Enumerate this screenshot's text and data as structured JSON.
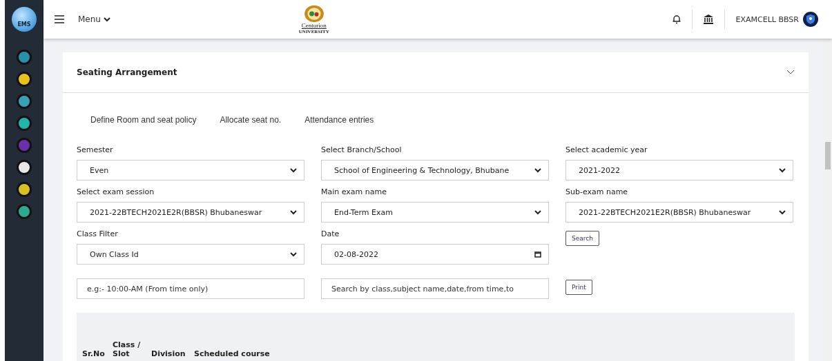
{
  "sidebar": {
    "logo": "EMS",
    "icons": [
      {
        "color": "#2a8fa8"
      },
      {
        "color": "#e8c21a"
      },
      {
        "color": "#3aa0b8"
      },
      {
        "color": "#1fb5a8"
      },
      {
        "color": "#6b2fa8"
      },
      {
        "color": "#e8e8e8"
      },
      {
        "color": "#d8c020"
      },
      {
        "color": "#2fa890"
      }
    ]
  },
  "topbar": {
    "menu": "Menu",
    "logo_name": "Centurion",
    "logo_sub": "UNIVERSITY",
    "user": "EXAMCELL BBSR"
  },
  "panel": {
    "title": "Seating Arrangement",
    "expanded": true
  },
  "links": [
    "Define Room and seat policy",
    "Allocate seat no.",
    "Attendance entries"
  ],
  "fields": [
    {
      "kind": "select",
      "label": "Semester",
      "value": "Even"
    },
    {
      "kind": "select",
      "label": "Select Branch/School",
      "value": "School of Engineering & Technology, Bhubane"
    },
    {
      "kind": "select",
      "label": "Select academic year",
      "value": "2021-2022"
    },
    {
      "kind": "select",
      "label": "Select exam session",
      "value": "2021-22BTECH2021E2R(BBSR) Bhubaneswar"
    },
    {
      "kind": "select",
      "label": "Main exam name",
      "value": "End-Term Exam"
    },
    {
      "kind": "select",
      "label": "Sub-exam name",
      "value": "2021-22BTECH2021E2R(BBSR) Bhubaneswar"
    },
    {
      "kind": "select",
      "label": "Class Filter",
      "value": "Own Class Id"
    },
    {
      "kind": "date",
      "label": "Date",
      "value": "02-08-2022"
    },
    {
      "kind": "button",
      "label": "Search"
    },
    {
      "kind": "text",
      "placeholder": "e.g:- 10:00-AM (From time only)"
    },
    {
      "kind": "text",
      "placeholder": "Search by class,subject name,date,from time,to"
    },
    {
      "kind": "button",
      "label": "Print"
    }
  ],
  "table": {
    "columns": [
      "Sr.No",
      "Class / Slot",
      "Division",
      "Scheduled course"
    ]
  }
}
